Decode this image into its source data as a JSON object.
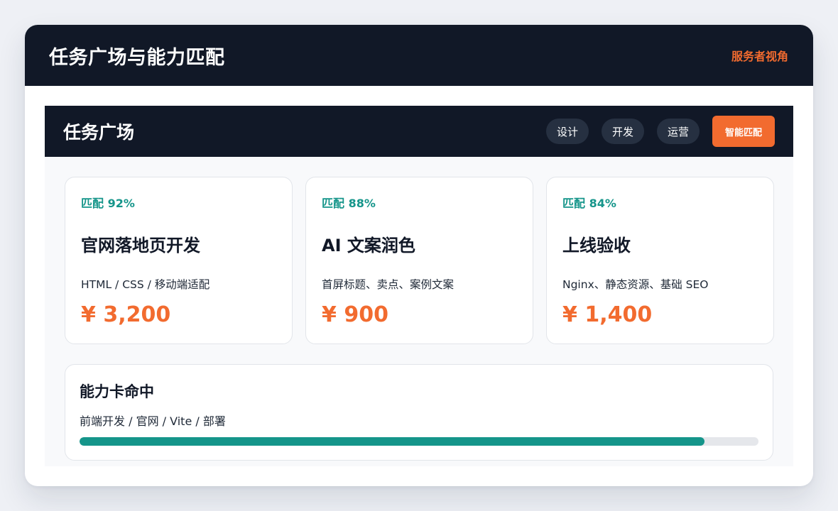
{
  "header": {
    "title": "任务广场与能力匹配",
    "view_label": "服务者视角"
  },
  "panel": {
    "title": "任务广场",
    "filters": [
      "设计",
      "开发",
      "运营"
    ],
    "match_button": "智能匹配"
  },
  "tasks": [
    {
      "match": "匹配 92%",
      "title": "官网落地页开发",
      "desc": "HTML / CSS / 移动端适配",
      "price": "¥ 3,200"
    },
    {
      "match": "匹配 88%",
      "title": "AI 文案润色",
      "desc": "首屏标题、卖点、案例文案",
      "price": "¥ 900"
    },
    {
      "match": "匹配 84%",
      "title": "上线验收",
      "desc": "Nginx、静态资源、基础 SEO",
      "price": "¥ 1,400"
    }
  ],
  "skill": {
    "title": "能力卡命中",
    "tags": "前端开发 / 官网 / Vite / 部署",
    "progress_percent": 92
  },
  "colors": {
    "accent": "#f26b2f",
    "dark": "#111827",
    "match": "#15958a"
  }
}
